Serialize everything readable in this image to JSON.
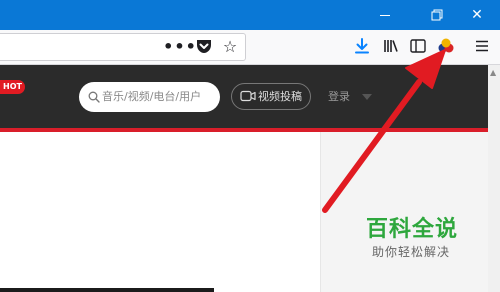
{
  "window": {
    "minimize_glyph": "—",
    "maximize_glyph": "❐",
    "close_glyph": "✕"
  },
  "toolbar": {
    "page_actions_glyph": "•••",
    "star_glyph": "☆",
    "icons": [
      "page-actions-icon",
      "pocket-icon",
      "bookmark-star-icon",
      "download-icon",
      "library-icon",
      "sidebar-icon",
      "extension-icon",
      "menu-icon"
    ]
  },
  "site": {
    "hot_badge": "HOT",
    "search_placeholder": "音乐/视频/电台/用户",
    "upload_label": "视频投稿",
    "login_label": "登录"
  },
  "watermark": {
    "title": "百科全说",
    "subtitle": "助你轻松解决"
  },
  "colors": {
    "titlebar": "#0a78d6",
    "header": "#2b2b2b",
    "accent_red": "#d91e2a",
    "arrow": "#e11b22",
    "watermark_green": "#2ea73d"
  }
}
